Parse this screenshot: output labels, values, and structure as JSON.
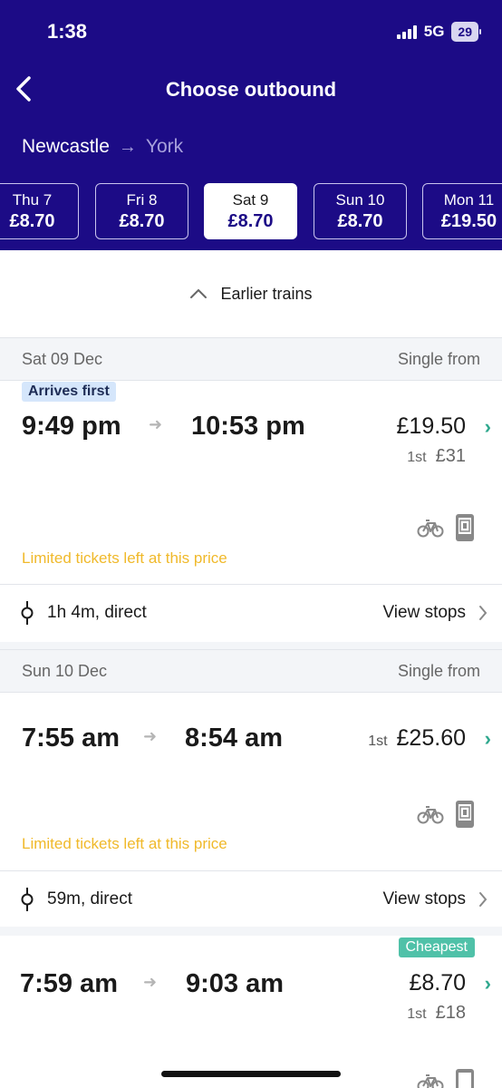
{
  "status": {
    "time": "1:38",
    "network": "5G",
    "battery": "29"
  },
  "header": {
    "title": "Choose outbound",
    "from": "Newcastle",
    "to": "York"
  },
  "dates": [
    {
      "day": "Thu 7",
      "price": "£8.70",
      "selected": false
    },
    {
      "day": "Fri 8",
      "price": "£8.70",
      "selected": false
    },
    {
      "day": "Sat 9",
      "price": "£8.70",
      "selected": true
    },
    {
      "day": "Sun 10",
      "price": "£8.70",
      "selected": false
    },
    {
      "day": "Mon 11",
      "price": "£19.50",
      "selected": false
    }
  ],
  "earlier_label": "Earlier trains",
  "sections": [
    {
      "date": "Sat 09 Dec",
      "single_from": "Single from"
    },
    {
      "date": "Sun 10 Dec",
      "single_from": "Single from"
    }
  ],
  "journeys": [
    {
      "badge": "Arrives first",
      "depart": "9:49 pm",
      "arrive": "10:53 pm",
      "price": "£19.50",
      "first_label": "1st",
      "first_price": "£31",
      "limited": "Limited tickets left at this price",
      "duration": "1h 4m, direct",
      "view_stops": "View stops"
    },
    {
      "depart": "7:55 am",
      "arrive": "8:54 am",
      "price_class": "1st",
      "price": "£25.60",
      "limited": "Limited tickets left at this price",
      "duration": "59m, direct",
      "view_stops": "View stops"
    },
    {
      "badge": "Cheapest",
      "depart": "7:59 am",
      "arrive": "9:03 am",
      "price": "£8.70",
      "first_label": "1st",
      "first_price": "£18"
    }
  ],
  "colors": {
    "brand": "#1c0b86",
    "accent": "#2fa88e",
    "warning": "#f0b92a",
    "cheapest": "#4fc1a8"
  }
}
